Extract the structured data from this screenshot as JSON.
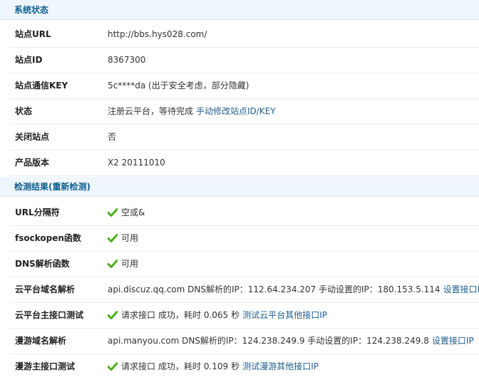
{
  "system_status": {
    "header": "系统状态",
    "rows": [
      {
        "label": "站点URL",
        "value": "http://bbs.hys028.com/"
      },
      {
        "label": "站点ID",
        "value": "8367300"
      },
      {
        "label": "站点通信KEY",
        "value": "5c****da (出于安全考虑，部分隐藏)"
      },
      {
        "label": "状态",
        "value": "注册云平台，等待完成",
        "link": "手动修改站点ID/KEY"
      },
      {
        "label": "关闭站点",
        "value": "否"
      },
      {
        "label": "产品版本",
        "value": "X2 20111010"
      }
    ]
  },
  "check_results": {
    "header": "检测结果",
    "recheck_link": "(重新检测)",
    "rows": [
      {
        "label": "URL分隔符",
        "value": "空或&",
        "status_icon": "check-icon"
      },
      {
        "label": "fsockopen函数",
        "value": "可用",
        "status_icon": "check-icon"
      },
      {
        "label": "DNS解析函数",
        "value": "可用",
        "status_icon": "check-icon"
      },
      {
        "label": "云平台域名解析",
        "value": "api.discuz.qq.com DNS解析的IP：112.64.234.207 手动设置的IP：180.153.5.114",
        "link": "设置接口IP"
      },
      {
        "label": "云平台主接口测试",
        "value": "请求接口 成功，耗时",
        "time": "0.065",
        "unit": "秒",
        "link": "测试云平台其他接口IP",
        "status_icon": "check-icon"
      },
      {
        "label": "漫游域名解析",
        "value": "api.manyou.com DNS解析的IP：124.238.249.9 手动设置的IP：124.238.249.8",
        "link": "设置接口IP"
      },
      {
        "label": "漫游主接口测试",
        "value": "请求接口 成功，耗时",
        "time": "0.109",
        "unit": "秒",
        "link": "测试漫游其他接口IP",
        "status_icon": "check-icon"
      }
    ]
  },
  "colors": {
    "header_bg": "#f0f7fc",
    "header_text": "#0f5e8f",
    "link": "#1e5d8f",
    "check": "#4caf1c"
  }
}
